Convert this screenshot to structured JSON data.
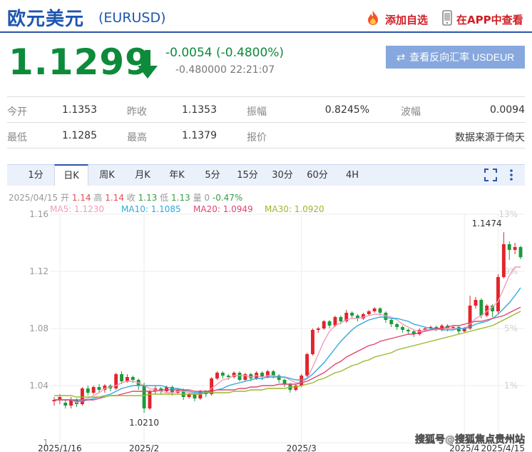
{
  "header": {
    "title": "欧元美元",
    "symbol": "(EURUSD)",
    "add_fav_label": "添加自选",
    "app_label": "在APP中查看"
  },
  "quote": {
    "price": "1.1299",
    "change": "-0.0054 (-0.4800%)",
    "sub_change": "-0.480000",
    "time": "22:21:07",
    "reverse_label": "查看反向汇率 USDEUR"
  },
  "stats": {
    "row1": [
      {
        "label": "今开",
        "value": "1.1353"
      },
      {
        "label": "昨收",
        "value": "1.1353"
      },
      {
        "label": "振幅",
        "value": "0.8245%"
      },
      {
        "label": "波幅",
        "value": "0.0094"
      }
    ],
    "row2": [
      {
        "label": "最低",
        "value": "1.1285"
      },
      {
        "label": "最高",
        "value": "1.1379"
      },
      {
        "label": "报价",
        "value": "数据来源于倚天"
      }
    ]
  },
  "tabs": [
    "1分",
    "日K",
    "周K",
    "月K",
    "年K",
    "5分",
    "15分",
    "30分",
    "60分",
    "4H"
  ],
  "active_tab": "日K",
  "info": {
    "date": "2025/04/15",
    "open_label": "开",
    "open": "1.14",
    "high_label": "高",
    "high": "1.14",
    "close_label": "收",
    "close": "1.13",
    "low_label": "低",
    "low": "1.13",
    "vol_label": "量",
    "vol": "0",
    "pct": "-0.47%"
  },
  "ma_labels": [
    {
      "text": "MA5: 1.1230",
      "color": "#f29bb8"
    },
    {
      "text": "MA10: 1.1085",
      "color": "#2eaadc"
    },
    {
      "text": "MA20: 1.0949",
      "color": "#e0466e"
    },
    {
      "text": "MA30: 1.0920",
      "color": "#9ab82c"
    }
  ],
  "watermark": "搜狐号@搜狐焦点贵州站",
  "chart_data": {
    "type": "candlestick",
    "ylim": [
      1.0,
      1.16
    ],
    "y_ticks": [
      "1.16",
      "1.12",
      "1.08",
      "1.04",
      "1"
    ],
    "y_tick_values": [
      1.16,
      1.12,
      1.08,
      1.04,
      1.0
    ],
    "right_ticks": [
      "13%",
      "9%",
      "5%",
      "1%"
    ],
    "right_tick_values": [
      1.16,
      1.12,
      1.08,
      1.04
    ],
    "x_labels": [
      "2025/1/16",
      "2025/2",
      "2025/3",
      "2025/4",
      "2025/4/15"
    ],
    "x_label_index": [
      1,
      16,
      44,
      73,
      79
    ],
    "annotations": [
      {
        "text": "1.1474",
        "index": 78,
        "value": 1.1474,
        "anchor": "high"
      },
      {
        "text": "1.0210",
        "index": 16,
        "value": 1.021,
        "anchor": "low"
      }
    ],
    "up_color": "#e3242b",
    "down_color": "#1a9b3b",
    "candles": [
      [
        1.029,
        1.03,
        1.026,
        1.032
      ],
      [
        1.03,
        1.032,
        1.027,
        1.034
      ],
      [
        1.028,
        1.026,
        1.024,
        1.03
      ],
      [
        1.026,
        1.03,
        1.024,
        1.032
      ],
      [
        1.03,
        1.027,
        1.025,
        1.031
      ],
      [
        1.027,
        1.038,
        1.026,
        1.039
      ],
      [
        1.038,
        1.035,
        1.033,
        1.04
      ],
      [
        1.035,
        1.039,
        1.034,
        1.04
      ],
      [
        1.039,
        1.037,
        1.035,
        1.041
      ],
      [
        1.037,
        1.04,
        1.035,
        1.041
      ],
      [
        1.04,
        1.038,
        1.036,
        1.041
      ],
      [
        1.038,
        1.048,
        1.037,
        1.049
      ],
      [
        1.048,
        1.043,
        1.041,
        1.05
      ],
      [
        1.043,
        1.046,
        1.042,
        1.048
      ],
      [
        1.046,
        1.044,
        1.042,
        1.047
      ],
      [
        1.044,
        1.04,
        1.037,
        1.045
      ],
      [
        1.04,
        1.024,
        1.021,
        1.042
      ],
      [
        1.024,
        1.036,
        1.023,
        1.037
      ],
      [
        1.036,
        1.038,
        1.034,
        1.04
      ],
      [
        1.038,
        1.036,
        1.034,
        1.039
      ],
      [
        1.036,
        1.039,
        1.035,
        1.04
      ],
      [
        1.039,
        1.035,
        1.033,
        1.04
      ],
      [
        1.035,
        1.037,
        1.034,
        1.038
      ],
      [
        1.037,
        1.032,
        1.03,
        1.038
      ],
      [
        1.032,
        1.034,
        1.031,
        1.035
      ],
      [
        1.034,
        1.031,
        1.029,
        1.035
      ],
      [
        1.031,
        1.036,
        1.03,
        1.037
      ],
      [
        1.036,
        1.034,
        1.032,
        1.037
      ],
      [
        1.034,
        1.045,
        1.033,
        1.046
      ],
      [
        1.045,
        1.049,
        1.044,
        1.05
      ],
      [
        1.049,
        1.047,
        1.045,
        1.05
      ],
      [
        1.047,
        1.046,
        1.044,
        1.048
      ],
      [
        1.046,
        1.049,
        1.045,
        1.05
      ],
      [
        1.049,
        1.044,
        1.043,
        1.05
      ],
      [
        1.044,
        1.048,
        1.043,
        1.049
      ],
      [
        1.048,
        1.045,
        1.043,
        1.049
      ],
      [
        1.045,
        1.049,
        1.044,
        1.05
      ],
      [
        1.049,
        1.046,
        1.044,
        1.05
      ],
      [
        1.046,
        1.05,
        1.045,
        1.051
      ],
      [
        1.05,
        1.047,
        1.045,
        1.051
      ],
      [
        1.047,
        1.044,
        1.042,
        1.048
      ],
      [
        1.044,
        1.041,
        1.039,
        1.045
      ],
      [
        1.041,
        1.037,
        1.035,
        1.042
      ],
      [
        1.037,
        1.04,
        1.036,
        1.041
      ],
      [
        1.04,
        1.047,
        1.039,
        1.048
      ],
      [
        1.047,
        1.062,
        1.046,
        1.063
      ],
      [
        1.062,
        1.079,
        1.061,
        1.08
      ],
      [
        1.079,
        1.08,
        1.077,
        1.081
      ],
      [
        1.08,
        1.085,
        1.079,
        1.086
      ],
      [
        1.085,
        1.082,
        1.08,
        1.086
      ],
      [
        1.082,
        1.088,
        1.081,
        1.089
      ],
      [
        1.088,
        1.085,
        1.083,
        1.089
      ],
      [
        1.085,
        1.091,
        1.084,
        1.093
      ],
      [
        1.091,
        1.089,
        1.087,
        1.092
      ],
      [
        1.089,
        1.087,
        1.085,
        1.09
      ],
      [
        1.087,
        1.09,
        1.086,
        1.091
      ],
      [
        1.09,
        1.092,
        1.089,
        1.093
      ],
      [
        1.092,
        1.094,
        1.091,
        1.095
      ],
      [
        1.094,
        1.091,
        1.089,
        1.095
      ],
      [
        1.091,
        1.086,
        1.084,
        1.092
      ],
      [
        1.086,
        1.083,
        1.081,
        1.087
      ],
      [
        1.083,
        1.081,
        1.079,
        1.084
      ],
      [
        1.081,
        1.079,
        1.077,
        1.082
      ],
      [
        1.079,
        1.078,
        1.076,
        1.08
      ],
      [
        1.078,
        1.076,
        1.074,
        1.079
      ],
      [
        1.076,
        1.079,
        1.075,
        1.08
      ],
      [
        1.079,
        1.08,
        1.078,
        1.081
      ],
      [
        1.08,
        1.081,
        1.079,
        1.082
      ],
      [
        1.081,
        1.079,
        1.078,
        1.082
      ],
      [
        1.079,
        1.082,
        1.078,
        1.083
      ],
      [
        1.082,
        1.08,
        1.078,
        1.083
      ],
      [
        1.08,
        1.081,
        1.079,
        1.082
      ],
      [
        1.081,
        1.078,
        1.076,
        1.082
      ],
      [
        1.078,
        1.08,
        1.077,
        1.081
      ],
      [
        1.08,
        1.096,
        1.079,
        1.103
      ],
      [
        1.096,
        1.1,
        1.094,
        1.102
      ],
      [
        1.1,
        1.089,
        1.087,
        1.101
      ],
      [
        1.089,
        1.096,
        1.088,
        1.097
      ],
      [
        1.096,
        1.092,
        1.088,
        1.097
      ],
      [
        1.092,
        1.116,
        1.09,
        1.118
      ],
      [
        1.116,
        1.139,
        1.115,
        1.1474
      ],
      [
        1.139,
        1.135,
        1.128,
        1.141
      ],
      [
        1.135,
        1.137,
        1.132,
        1.14
      ],
      [
        1.137,
        1.1299,
        1.1285,
        1.1379
      ]
    ],
    "ma5": [
      1.03,
      1.03,
      1.03,
      1.03,
      1.028,
      1.03,
      1.031,
      1.033,
      1.035,
      1.038,
      1.039,
      1.04,
      1.042,
      1.043,
      1.043,
      1.042,
      1.04,
      1.038,
      1.037,
      1.036,
      1.035,
      1.035,
      1.036,
      1.036,
      1.035,
      1.034,
      1.034,
      1.035,
      1.038,
      1.041,
      1.044,
      1.045,
      1.047,
      1.047,
      1.047,
      1.046,
      1.047,
      1.046,
      1.047,
      1.047,
      1.046,
      1.046,
      1.044,
      1.042,
      1.042,
      1.045,
      1.053,
      1.062,
      1.071,
      1.078,
      1.082,
      1.084,
      1.086,
      1.087,
      1.087,
      1.088,
      1.089,
      1.09,
      1.09,
      1.089,
      1.088,
      1.086,
      1.083,
      1.081,
      1.079,
      1.078,
      1.079,
      1.079,
      1.079,
      1.08,
      1.08,
      1.08,
      1.08,
      1.08,
      1.083,
      1.087,
      1.089,
      1.092,
      1.095,
      1.099,
      1.108,
      1.117,
      1.123,
      1.123
    ],
    "ma10": [
      1.03,
      1.03,
      1.03,
      1.03,
      1.029,
      1.029,
      1.03,
      1.031,
      1.032,
      1.033,
      1.034,
      1.036,
      1.038,
      1.039,
      1.04,
      1.04,
      1.04,
      1.04,
      1.04,
      1.04,
      1.039,
      1.038,
      1.038,
      1.037,
      1.036,
      1.035,
      1.035,
      1.035,
      1.036,
      1.037,
      1.038,
      1.04,
      1.041,
      1.042,
      1.043,
      1.044,
      1.045,
      1.045,
      1.046,
      1.046,
      1.046,
      1.046,
      1.045,
      1.044,
      1.044,
      1.045,
      1.048,
      1.052,
      1.056,
      1.061,
      1.066,
      1.071,
      1.075,
      1.079,
      1.082,
      1.084,
      1.086,
      1.087,
      1.088,
      1.088,
      1.087,
      1.087,
      1.086,
      1.085,
      1.083,
      1.082,
      1.081,
      1.08,
      1.08,
      1.079,
      1.079,
      1.079,
      1.08,
      1.08,
      1.081,
      1.083,
      1.084,
      1.085,
      1.087,
      1.09,
      1.094,
      1.098,
      1.103,
      1.1085
    ],
    "ma20": [
      1.03,
      1.03,
      1.03,
      1.03,
      1.03,
      1.03,
      1.03,
      1.03,
      1.031,
      1.032,
      1.033,
      1.033,
      1.034,
      1.035,
      1.036,
      1.036,
      1.036,
      1.036,
      1.036,
      1.037,
      1.037,
      1.037,
      1.037,
      1.037,
      1.037,
      1.036,
      1.036,
      1.036,
      1.036,
      1.037,
      1.037,
      1.037,
      1.037,
      1.038,
      1.038,
      1.039,
      1.039,
      1.04,
      1.04,
      1.04,
      1.041,
      1.041,
      1.041,
      1.041,
      1.042,
      1.043,
      1.045,
      1.047,
      1.049,
      1.052,
      1.055,
      1.057,
      1.06,
      1.062,
      1.064,
      1.066,
      1.068,
      1.069,
      1.071,
      1.072,
      1.073,
      1.074,
      1.075,
      1.076,
      1.076,
      1.077,
      1.078,
      1.079,
      1.08,
      1.08,
      1.081,
      1.082,
      1.082,
      1.083,
      1.084,
      1.085,
      1.085,
      1.086,
      1.087,
      1.088,
      1.089,
      1.091,
      1.093,
      1.0949
    ],
    "ma30": [
      1.033,
      1.033,
      1.033,
      1.033,
      1.032,
      1.032,
      1.032,
      1.032,
      1.032,
      1.032,
      1.033,
      1.033,
      1.033,
      1.033,
      1.033,
      1.033,
      1.033,
      1.034,
      1.034,
      1.034,
      1.034,
      1.034,
      1.034,
      1.034,
      1.034,
      1.034,
      1.034,
      1.035,
      1.035,
      1.035,
      1.035,
      1.035,
      1.036,
      1.036,
      1.036,
      1.037,
      1.037,
      1.037,
      1.038,
      1.038,
      1.038,
      1.038,
      1.039,
      1.039,
      1.04,
      1.041,
      1.042,
      1.044,
      1.045,
      1.047,
      1.049,
      1.05,
      1.052,
      1.054,
      1.055,
      1.057,
      1.058,
      1.06,
      1.061,
      1.062,
      1.063,
      1.065,
      1.066,
      1.067,
      1.068,
      1.069,
      1.07,
      1.071,
      1.072,
      1.073,
      1.074,
      1.075,
      1.076,
      1.077,
      1.078,
      1.079,
      1.08,
      1.081,
      1.082,
      1.084,
      1.086,
      1.088,
      1.09,
      1.092
    ]
  }
}
